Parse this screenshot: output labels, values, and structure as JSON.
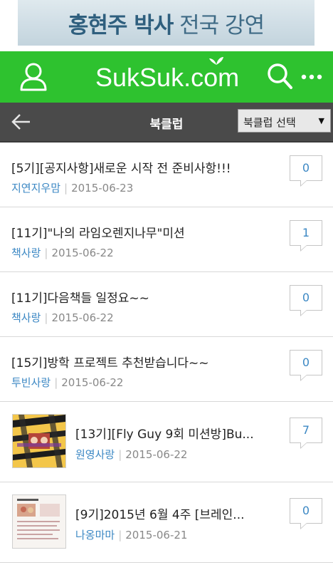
{
  "banner": {
    "part1": "홍현주 박사",
    "part2": " 전국 강연"
  },
  "header": {
    "logo_text_a": "SukSuk.c",
    "logo_text_o": "o",
    "logo_text_b": "m"
  },
  "subheader": {
    "title": "북클럽",
    "select_value": "북클럽 선택",
    "select_arrow": "▼"
  },
  "posts": [
    {
      "title": "[5기][공지사항]새로운 시작 전 준비사항!!!",
      "author": "지연지우맘",
      "date": "2015-06-23",
      "comments": "0"
    },
    {
      "title": "[11기]\"나의 라임오렌지나무\"미션",
      "author": "책사랑",
      "date": "2015-06-22",
      "comments": "1"
    },
    {
      "title": "[11기]다음책들 일정요~~",
      "author": "책사랑",
      "date": "2015-06-22",
      "comments": "0"
    },
    {
      "title": "[15기]방학 프로젝트 추천받습니다~~",
      "author": "투빈사랑",
      "date": "2015-06-22",
      "comments": "0"
    },
    {
      "title": "[13기][Fly Guy 9회 미션방]Bu...",
      "author": "원영사랑",
      "date": "2015-06-22",
      "comments": "7"
    },
    {
      "title": "[9기]2015년 6월 4주 [브레인...",
      "author": "나옹마마",
      "date": "2015-06-21",
      "comments": "0"
    }
  ],
  "colors": {
    "brand_green": "#2ec22f",
    "subbar": "#4a4a4a",
    "link_blue": "#3c88c4"
  },
  "icons": {
    "user": "user-icon",
    "search": "search-icon",
    "more": "more-icon",
    "back": "back-arrow-icon"
  }
}
